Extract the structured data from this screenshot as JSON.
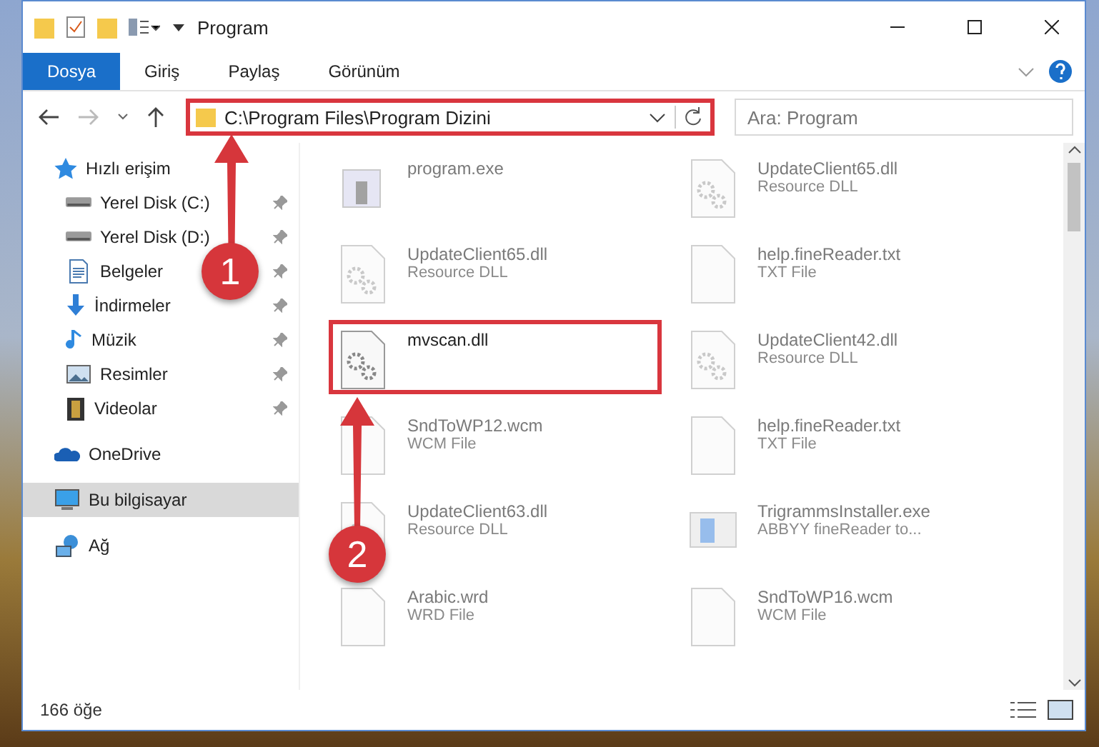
{
  "window": {
    "title": "Program"
  },
  "ribbon_tabs": [
    {
      "label": "Dosya",
      "selected": true
    },
    {
      "label": "Giriş",
      "selected": false
    },
    {
      "label": "Paylaş",
      "selected": false
    },
    {
      "label": "Görünüm",
      "selected": false
    }
  ],
  "address_bar": {
    "path": "C:\\Program Files\\Program Dizini",
    "highlighted": true
  },
  "search": {
    "placeholder": "Ara: Program"
  },
  "sidebar": {
    "items": [
      {
        "label": "Hızlı erişim",
        "kind": "star",
        "selected": false,
        "children": [
          {
            "label": "Yerel Disk (C:)",
            "kind": "drive",
            "selected": false,
            "pinned": true
          },
          {
            "label": "Yerel Disk (D:)",
            "kind": "drive",
            "selected": false,
            "pinned": true
          },
          {
            "label": "Belgeler",
            "kind": "document",
            "selected": false,
            "pinned": true
          },
          {
            "label": "İndirmeler",
            "kind": "download",
            "selected": false,
            "pinned": true
          },
          {
            "label": "Müzik",
            "kind": "music",
            "selected": false,
            "pinned": true
          },
          {
            "label": "Resimler",
            "kind": "pictures",
            "selected": false,
            "pinned": true
          },
          {
            "label": "Videolar",
            "kind": "video",
            "selected": false,
            "pinned": true
          }
        ]
      },
      {
        "label": "OneDrive",
        "kind": "cloud",
        "selected": false
      },
      {
        "label": "Bu bilgisayar",
        "kind": "computer",
        "selected": true
      },
      {
        "label": "Ağ",
        "kind": "network",
        "selected": false
      }
    ]
  },
  "files": [
    {
      "name": "program.exe",
      "kind": "exe",
      "faded": true,
      "highlighted": false
    },
    {
      "name": "UpdateClient65.dll",
      "type": "Resource DLL",
      "kind": "dll",
      "faded": true,
      "highlighted": false
    },
    {
      "name": "UpdateClient65.dll",
      "type": "Resource DLL",
      "kind": "dll",
      "faded": true,
      "highlighted": false
    },
    {
      "name": "help.fineReader.txt",
      "type": "TXT File",
      "kind": "txt",
      "faded": true,
      "highlighted": false
    },
    {
      "name": "mvscan.dll",
      "kind": "dll",
      "faded": false,
      "highlighted": true
    },
    {
      "name": "UpdateClient42.dll",
      "type": "Resource DLL",
      "kind": "dll",
      "faded": true,
      "highlighted": false
    },
    {
      "name": "SndToWP12.wcm",
      "type": "WCM File",
      "kind": "txt",
      "faded": true,
      "highlighted": false
    },
    {
      "name": "help.fineReader.txt",
      "type": "TXT File",
      "kind": "txt",
      "faded": true,
      "highlighted": false
    },
    {
      "name": "UpdateClient63.dll",
      "type": "Resource DLL",
      "kind": "dll",
      "faded": true,
      "highlighted": false
    },
    {
      "name": "TrigrammsInstaller.exe",
      "type": "ABBYY fineReader to...",
      "kind": "installer",
      "faded": true,
      "highlighted": false
    },
    {
      "name": "Arabic.wrd",
      "type": "WRD File",
      "kind": "txt",
      "faded": true,
      "highlighted": false
    },
    {
      "name": "SndToWP16.wcm",
      "type": "WCM File",
      "kind": "txt",
      "faded": true,
      "highlighted": false
    }
  ],
  "status_bar": {
    "item_count": "166 öğe"
  },
  "annotations": [
    {
      "number": "1"
    },
    {
      "number": "2"
    }
  ]
}
